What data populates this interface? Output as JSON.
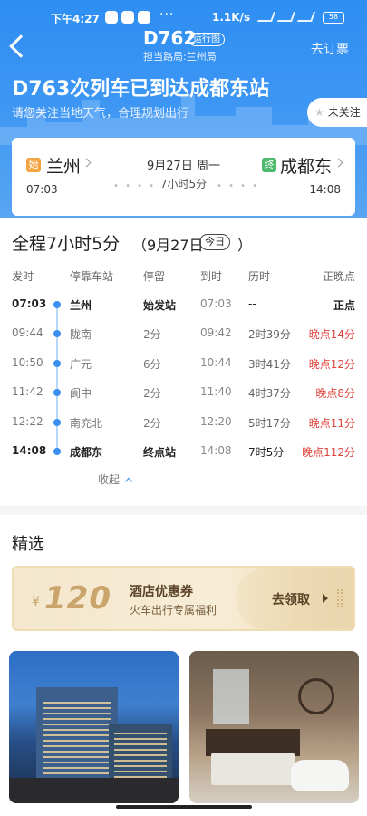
{
  "status_bar": {
    "time": "下午4:27",
    "dots": "···",
    "network_speed": "1.1K/s",
    "battery": "58"
  },
  "header": {
    "train_no": "D762",
    "route_tag": "运行图",
    "bureau": "担当路局:兰州局",
    "buy_ticket": "去订票",
    "arrival_notice": "D763次列车已到达成都东站",
    "weather_tip": "请您关注当地天气，合理规划出行",
    "follow_label": "未关注"
  },
  "trip": {
    "from_badge": "始",
    "from_station": "兰州",
    "departure_time": "07:03",
    "date": "9月27日 周一",
    "duration": "7小时5分",
    "to_badge": "终",
    "to_station": "成都东",
    "arrival_time": "14:08"
  },
  "schedule": {
    "title": "全程7小时5分",
    "date": "（9月27日",
    "today_badge": "今日",
    "date_close": "）",
    "headers": [
      "发时",
      "停靠车站",
      "停留",
      "到时",
      "历时",
      "正晚点"
    ],
    "rows": [
      {
        "dep": "07:03",
        "station": "兰州",
        "stop": "始发站",
        "arr": "07:03",
        "elapsed": "--",
        "status": "正点",
        "highlight": true,
        "ontime": true
      },
      {
        "dep": "09:44",
        "station": "陇南",
        "stop": "2分",
        "arr": "09:42",
        "elapsed": "2时39分",
        "status": "晚点14分",
        "highlight": false,
        "ontime": false
      },
      {
        "dep": "10:50",
        "station": "广元",
        "stop": "6分",
        "arr": "10:44",
        "elapsed": "3时41分",
        "status": "晚点12分",
        "highlight": false,
        "ontime": false
      },
      {
        "dep": "11:42",
        "station": "阆中",
        "stop": "2分",
        "arr": "11:40",
        "elapsed": "4时37分",
        "status": "晚点8分",
        "highlight": false,
        "ontime": false
      },
      {
        "dep": "12:22",
        "station": "南充北",
        "stop": "2分",
        "arr": "12:20",
        "elapsed": "5时17分",
        "status": "晚点11分",
        "highlight": false,
        "ontime": false
      },
      {
        "dep": "14:08",
        "station": "成都东",
        "stop": "终点站",
        "arr": "14:08",
        "elapsed": "7时5分",
        "status": "晚点112分",
        "highlight": true,
        "ontime": false
      }
    ],
    "collapse_label": "收起"
  },
  "picks": {
    "title": "精选",
    "coupon": {
      "currency": "¥",
      "amount": "120",
      "name": "酒店优惠券",
      "desc": "火车出行专属福利",
      "button": "去领取"
    }
  },
  "colors": {
    "primary": "#3a8ff0",
    "late": "#e0443c",
    "coupon_gold": "#caa46b"
  }
}
